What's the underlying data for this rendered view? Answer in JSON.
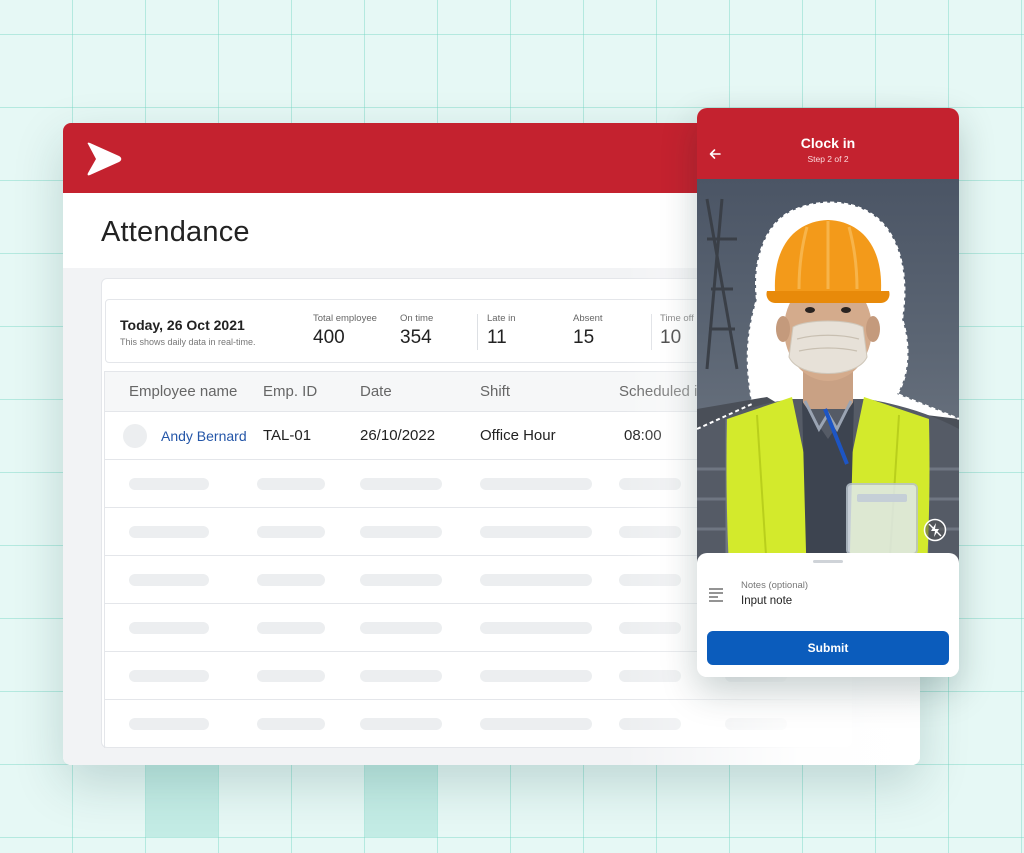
{
  "header": {
    "logo_icon": "chevron-logo-icon",
    "brand_color": "#c4222f"
  },
  "page": {
    "title": "Attendance"
  },
  "summary": {
    "date": "Today, 26 Oct 2021",
    "subtitle": "This shows daily data in real-time.",
    "stats": [
      {
        "label": "Total employee",
        "value": "400"
      },
      {
        "label": "On time",
        "value": "354"
      },
      {
        "label": "Late in",
        "value": "11"
      },
      {
        "label": "Absent",
        "value": "15"
      },
      {
        "label": "Time off",
        "value": "10"
      }
    ]
  },
  "table": {
    "columns": [
      "Employee name",
      "Emp. ID",
      "Date",
      "Shift",
      "Scheduled i"
    ],
    "rows": [
      {
        "name": "Andy Bernard",
        "emp_id": "TAL-01",
        "date": "26/10/2022",
        "shift": "Office Hour",
        "scheduled": "08:00"
      }
    ],
    "placeholder_rows": 6
  },
  "mobile": {
    "title": "Clock in",
    "subtitle": "Step 2 of 2",
    "back_icon": "arrow-left-icon",
    "flash_icon": "flash-off-icon",
    "notes_icon": "notes-lines-icon",
    "notes_label": "Notes (optional)",
    "notes_placeholder": "Input note",
    "submit_label": "Submit",
    "submit_color": "#0b5cbc"
  }
}
